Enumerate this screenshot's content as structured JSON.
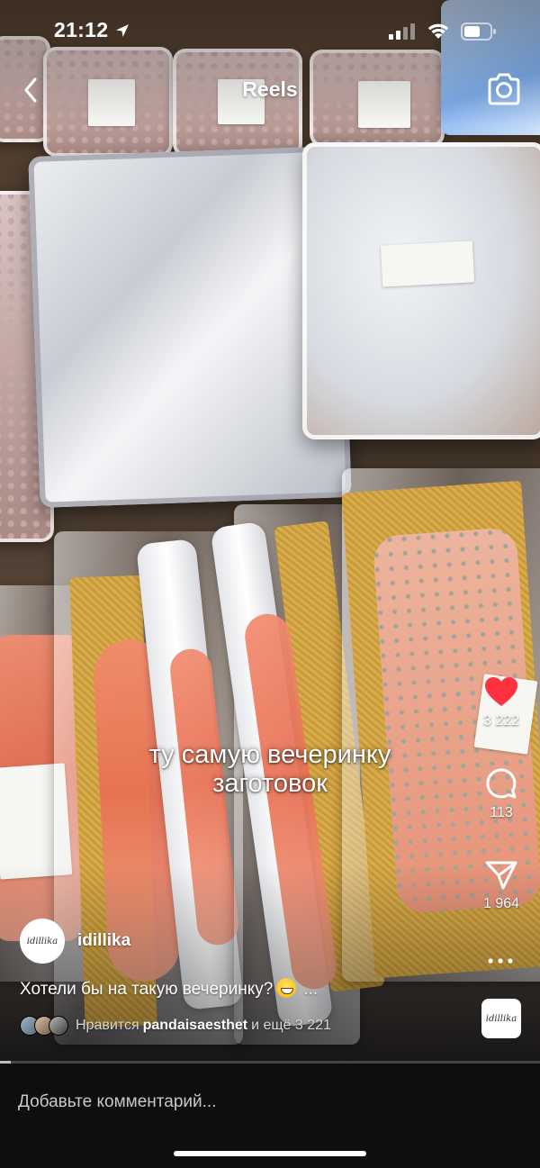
{
  "status_bar": {
    "time": "21:12",
    "icons": [
      "location-arrow-icon",
      "signal-icon",
      "wifi-icon",
      "battery-icon"
    ]
  },
  "header": {
    "title": "Reels",
    "back_icon": "chevron-left-icon",
    "camera_icon": "camera-icon"
  },
  "video": {
    "caption_line1": "ту самую вечеринку",
    "caption_line2": "заготовок"
  },
  "actions": {
    "likes": "3 222",
    "comments": "113",
    "shares": "1 964",
    "liked": true,
    "like_color": "#ff3040"
  },
  "author": {
    "avatar_text": "idillika",
    "username": "idillika"
  },
  "post": {
    "description": "Хотели бы на такую вечеринку?",
    "more": "...",
    "likes_prefix": "Нравится",
    "likes_user": "pandaisaesthet",
    "likes_suffix": "и ещё 3 221",
    "audio_thumb_text": "idillika"
  },
  "comment_bar": {
    "placeholder": "Добавьте комментарий..."
  },
  "playback": {
    "progress_fraction": 0.02
  }
}
